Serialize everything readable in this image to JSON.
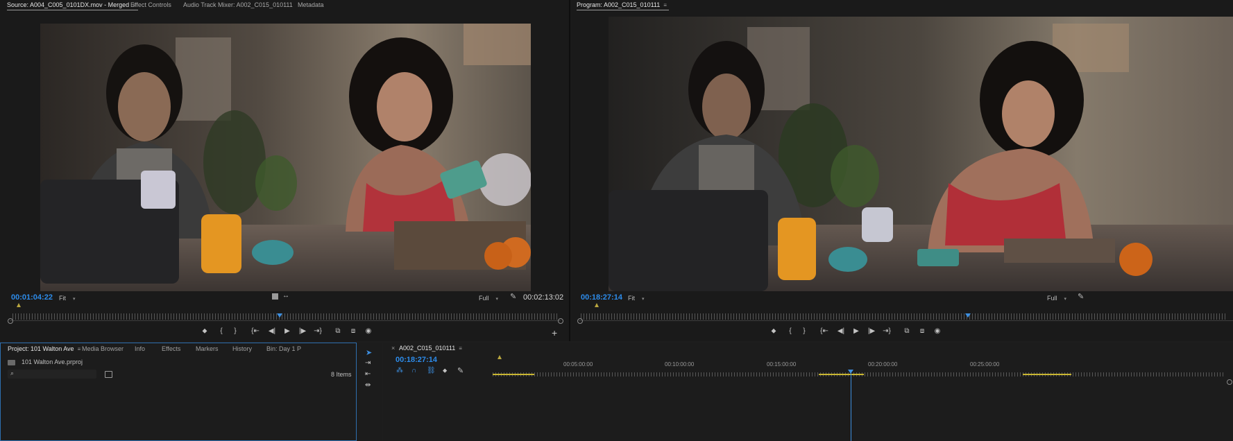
{
  "source_panel": {
    "tabs": [
      {
        "label": "Source: A004_C005_0101DX.mov - Merged",
        "active": true
      },
      {
        "label": "Effect Controls",
        "active": false
      },
      {
        "label": "Audio Track Mixer: A002_C015_010111",
        "active": false
      },
      {
        "label": "Metadata",
        "active": false
      }
    ],
    "timecode_current": "00:01:04:22",
    "fit_label": "Fit",
    "full_label": "Full",
    "timecode_duration": "00:02:13:02",
    "playhead_fraction": 0.49
  },
  "program_panel": {
    "tab_label": "Program: A002_C015_010111",
    "timecode_current": "00:18:27:14",
    "fit_label": "Fit",
    "full_label": "Full",
    "playhead_fraction": 0.6
  },
  "transport_icons": [
    "marker-icon",
    "mark-in-icon",
    "mark-out-icon",
    "go-to-in-icon",
    "step-back-icon",
    "play-icon",
    "step-forward-icon",
    "go-to-out-icon",
    "insert-icon",
    "overwrite-icon",
    "export-frame-icon"
  ],
  "transport_glyphs": [
    "⬥",
    "{",
    "}",
    "{⇤",
    "◀|",
    "▶",
    "|▶",
    "⇥}",
    "⧉",
    "⧈",
    "◉"
  ],
  "project_panel": {
    "tabs": [
      {
        "label": "Project: 101 Walton Ave",
        "active": true
      },
      {
        "label": "Media Browser",
        "active": false
      },
      {
        "label": "Info",
        "active": false
      },
      {
        "label": "Effects",
        "active": false
      },
      {
        "label": "Markers",
        "active": false
      },
      {
        "label": "History",
        "active": false
      },
      {
        "label": "Bin: Day 1 P",
        "active": false
      }
    ],
    "project_file": "101 Walton Ave.prproj",
    "search_placeholder": "",
    "items_count": "8 Items"
  },
  "timeline_panel": {
    "close_glyph": "×",
    "sequence_name": "A002_C015_010111",
    "timecode": "00:18:27:14",
    "ruler_labels": [
      "00:05:00:00",
      "00:10:00:00",
      "00:15:00:00",
      "00:20:00:00",
      "00:25:00:00"
    ]
  },
  "colors": {
    "accent_blue": "#2d8ceb",
    "panel_bg": "#1a1a1a",
    "in_out_yellow": "#c9b632"
  }
}
